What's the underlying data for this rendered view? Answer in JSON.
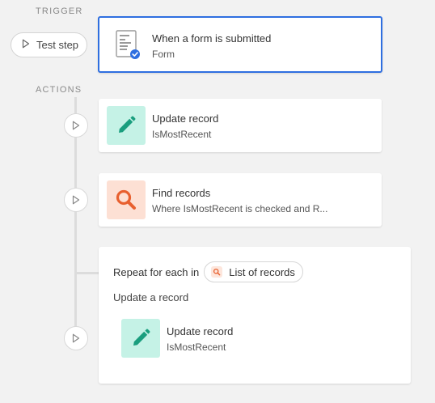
{
  "sections": {
    "trigger_label": "TRIGGER",
    "actions_label": "ACTIONS"
  },
  "test_step": {
    "label": "Test step"
  },
  "trigger": {
    "title": "When a form is submitted",
    "subtitle": "Form",
    "icon": "form-icon",
    "selected": true
  },
  "actions": [
    {
      "title": "Update record",
      "subtitle": "IsMostRecent",
      "icon": "pencil-icon",
      "icon_bg": "#c5f2e6",
      "icon_color": "#1a9e7e"
    },
    {
      "title": "Find records",
      "subtitle": "Where IsMostRecent is checked and R...",
      "icon": "search-icon",
      "icon_bg": "#fde0d4",
      "icon_color": "#e8602f"
    }
  ],
  "repeat": {
    "prefix": "Repeat for each in",
    "source_label": "List of records",
    "source_icon": "search-icon",
    "description": "Update a record",
    "nested_action": {
      "title": "Update record",
      "subtitle": "IsMostRecent",
      "icon": "pencil-icon",
      "icon_bg": "#c5f2e6",
      "icon_color": "#1a9e7e"
    }
  },
  "colors": {
    "selection_border": "#2f6fe0",
    "background": "#f2f2f2",
    "connector": "#dcdcdc"
  }
}
